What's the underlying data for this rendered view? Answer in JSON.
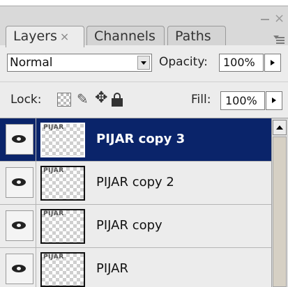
{
  "tabs": [
    {
      "label": "Layers",
      "close": "×",
      "active": true
    },
    {
      "label": "Channels",
      "active": false
    },
    {
      "label": "Paths",
      "active": false
    }
  ],
  "window_controls": {
    "minimize": "–",
    "close": "×"
  },
  "options": {
    "blend_mode": "Normal",
    "opacity_label": "Opacity:",
    "opacity_value": "100%"
  },
  "lock": {
    "label": "Lock:",
    "icons": [
      "lock-transparent-icon",
      "lock-image-icon",
      "lock-position-icon",
      "lock-all-icon"
    ],
    "image_glyph": "✎",
    "position_glyph": "✥",
    "fill_label": "Fill:",
    "fill_value": "100%"
  },
  "layers": [
    {
      "name": "PIJAR copy 3",
      "thumb_text": "PIJAR",
      "visible": true,
      "selected": true
    },
    {
      "name": "PIJAR copy 2",
      "thumb_text": "PIJAR",
      "visible": true,
      "selected": false
    },
    {
      "name": "PIJAR copy",
      "thumb_text": "PIJAR",
      "visible": true,
      "selected": false
    },
    {
      "name": "PIJAR",
      "thumb_text": "PIJAR",
      "visible": true,
      "selected": false
    }
  ],
  "colors": {
    "selection": "#0a246a",
    "panel": "#ececec"
  }
}
